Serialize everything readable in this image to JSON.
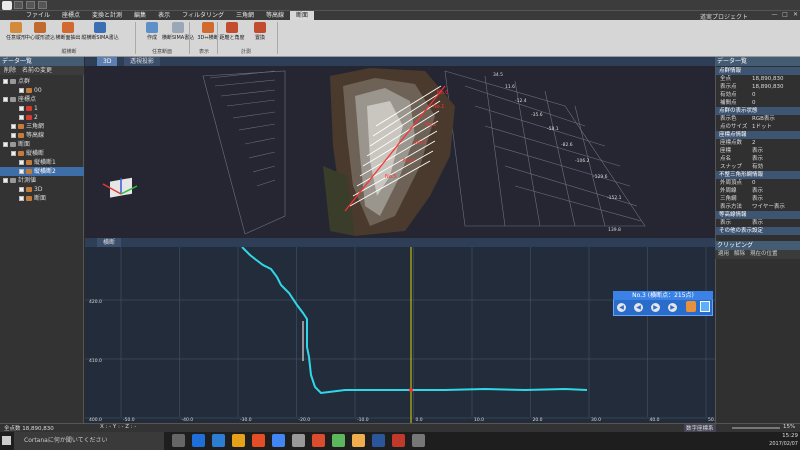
{
  "window": {
    "project": "道実プロジェクト"
  },
  "menu": [
    "ファイル",
    "座標点",
    "変換と計測",
    "編集",
    "表示",
    "フィルタリング",
    "三角網",
    "等高線",
    "断面"
  ],
  "menu_active": "断面",
  "ribbon": {
    "buttons": [
      {
        "label": "任意縦形",
        "color": "#d28a3c"
      },
      {
        "label": "中心縦形読込",
        "color": "#c26a2e"
      },
      {
        "label": "横断面抽出",
        "color": "#d06a2f"
      },
      {
        "label": "縦横断SIMA書込",
        "color": "#3b6fb3"
      },
      {
        "label": "作成",
        "color": "#5d90c8"
      },
      {
        "label": "横断SIMA書込",
        "color": "#9aa7b6"
      },
      {
        "label": "3D⇔横断",
        "color": "#d06a2f"
      },
      {
        "label": "距離と角度",
        "color": "#c44c2e"
      },
      {
        "label": "置換",
        "color": "#c44c2e"
      }
    ],
    "groups": [
      "縦横断",
      "任意断面",
      "表示",
      "計測"
    ]
  },
  "left_panel": {
    "title": "データ一覧",
    "tools": [
      "削除",
      "名前の変更"
    ],
    "tree": [
      {
        "label": "点群",
        "indent": 0,
        "icon": "grey",
        "selected": false
      },
      {
        "label": "00",
        "indent": 2,
        "icon": "orange",
        "selected": false
      },
      {
        "label": "座標点",
        "indent": 0,
        "icon": "grey",
        "selected": false
      },
      {
        "label": "1",
        "indent": 2,
        "icon": "red",
        "selected": false
      },
      {
        "label": "2",
        "indent": 2,
        "icon": "red",
        "selected": false
      },
      {
        "label": "三角網",
        "indent": 1,
        "icon": "orange",
        "selected": false
      },
      {
        "label": "等高線",
        "indent": 1,
        "icon": "orange",
        "selected": false
      },
      {
        "label": "断面",
        "indent": 0,
        "icon": "grey",
        "selected": false
      },
      {
        "label": "縦横断",
        "indent": 1,
        "icon": "orange",
        "selected": false
      },
      {
        "label": "縦横断1",
        "indent": 2,
        "icon": "orange",
        "selected": false
      },
      {
        "label": "縦横断2",
        "indent": 2,
        "icon": "orange",
        "selected": true
      },
      {
        "label": "計測値",
        "indent": 0,
        "icon": "grey",
        "selected": false
      },
      {
        "label": "3D",
        "indent": 2,
        "icon": "orange",
        "selected": false
      },
      {
        "label": "断面",
        "indent": 2,
        "icon": "orange",
        "selected": false
      }
    ]
  },
  "view3d": {
    "tabs": [
      "3D",
      "透視投影"
    ],
    "tick_labels": [
      "34.5",
      "11.6",
      "-12.4",
      "-35.6",
      "-58.1",
      "-82.6",
      "-106.2",
      "-129.6",
      "-152.1",
      "139.8"
    ]
  },
  "profile": {
    "tab": "横断",
    "y_labels": [
      "420.0",
      "410.0",
      "400.0"
    ],
    "x_labels": [
      "-50.0",
      "-40.0",
      "-30.0",
      "-20.0",
      "-10.0",
      "0.0",
      "10.0",
      "20.0",
      "30.0",
      "40.0",
      "50.0"
    ],
    "popup_title": "No.3 (横断点：215点)",
    "popup_buttons": [
      "◀",
      "◀",
      "▶",
      "▶"
    ]
  },
  "right_panel": {
    "title": "データ一覧",
    "sections": [
      {
        "title": "点群情報",
        "rows": [
          [
            "全点",
            "18,890,830"
          ],
          [
            "表示点",
            "18,890,830"
          ],
          [
            "有効点",
            "0"
          ],
          [
            "補間点",
            "0"
          ]
        ]
      },
      {
        "title": "点群の表示状態",
        "rows": [
          [
            "表示色",
            "RGB表示"
          ],
          [
            "点のサイズ",
            "1ドット"
          ]
        ]
      },
      {
        "title": "座標点情報",
        "rows": [
          [
            "座標点数",
            "2"
          ],
          [
            "座標",
            "表示"
          ],
          [
            "点名",
            "表示"
          ],
          [
            "スナップ",
            "有効"
          ]
        ]
      },
      {
        "title": "不整三角形網情報",
        "rows": [
          [
            "外周頂点",
            "0"
          ],
          [
            "外周線",
            "表示"
          ],
          [
            "三角網",
            "表示"
          ],
          [
            "表示方法",
            "ワイヤー表示"
          ]
        ]
      },
      {
        "title": "等高線情報",
        "rows": [
          [
            "表示",
            "表示"
          ]
        ]
      },
      {
        "title": "その他の表示設定",
        "rows": []
      }
    ],
    "clip_title": "クリッピング",
    "clip_tools": [
      "適用",
      "解除",
      "現在の位置"
    ]
  },
  "status": {
    "left": "全点数 18,890,830",
    "coords": "X : - Y : - Z : -",
    "right": "数字座標系",
    "zoom": "15%"
  },
  "taskbar": {
    "search": "Cortanaに何か聞いてください",
    "time": "15:29",
    "date": "2017/02/07"
  }
}
